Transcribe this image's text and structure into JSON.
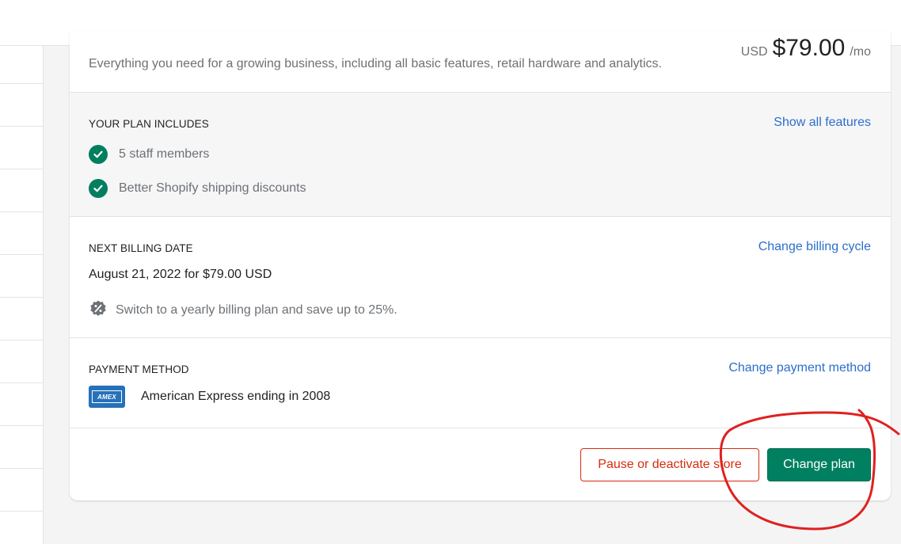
{
  "plan": {
    "description": "Everything you need for a growing business, including all basic features, retail hardware and analytics.",
    "price_currency": "USD",
    "price_amount": "$79.00",
    "price_unit": "/mo"
  },
  "includes": {
    "title": "YOUR PLAN INCLUDES",
    "link": "Show all features",
    "features": [
      "5 staff members",
      "Better Shopify shipping discounts"
    ]
  },
  "billing": {
    "title": "NEXT BILLING DATE",
    "link": "Change billing cycle",
    "date_text": "August 21, 2022 for $79.00 USD",
    "tip": "Switch to a yearly billing plan and save up to 25%."
  },
  "payment": {
    "title": "PAYMENT METHOD",
    "link": "Change payment method",
    "card_brand": "AMEX",
    "card_text": "American Express ending in 2008"
  },
  "actions": {
    "pause_label": "Pause or deactivate store",
    "change_plan_label": "Change plan"
  },
  "colors": {
    "accent_green": "#008060",
    "link_blue": "#2c6ecb",
    "critical_red": "#d72c0d",
    "annotation_red": "#e02020"
  },
  "icons": {
    "check": "check-circle-icon",
    "discount": "discount-badge-icon",
    "card": "amex-card-icon"
  }
}
